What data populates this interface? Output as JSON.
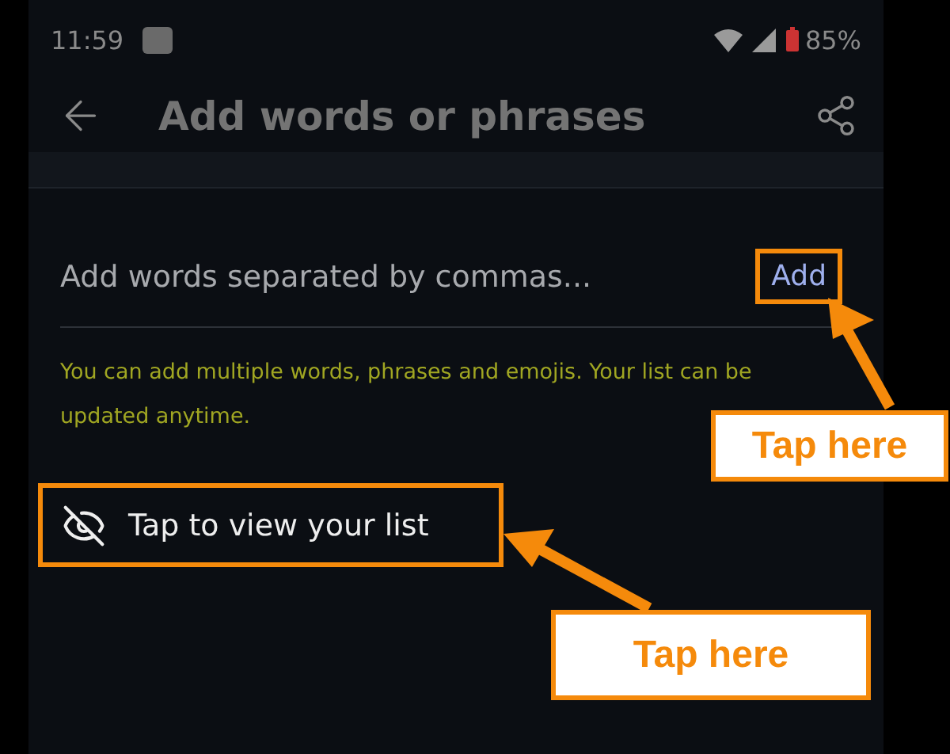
{
  "status_bar": {
    "time": "11:59",
    "battery": "85%"
  },
  "app_bar": {
    "title": "Add words or phrases"
  },
  "word_input": {
    "placeholder": "Add words separated by commas...",
    "action": "Add"
  },
  "helper_text": "You can add multiple words, phrases and emojis. Your list can be updated anytime.",
  "view_list": {
    "label": "Tap to view your list"
  },
  "callouts": [
    {
      "label": "Tap here"
    },
    {
      "label": "Tap here"
    }
  ]
}
